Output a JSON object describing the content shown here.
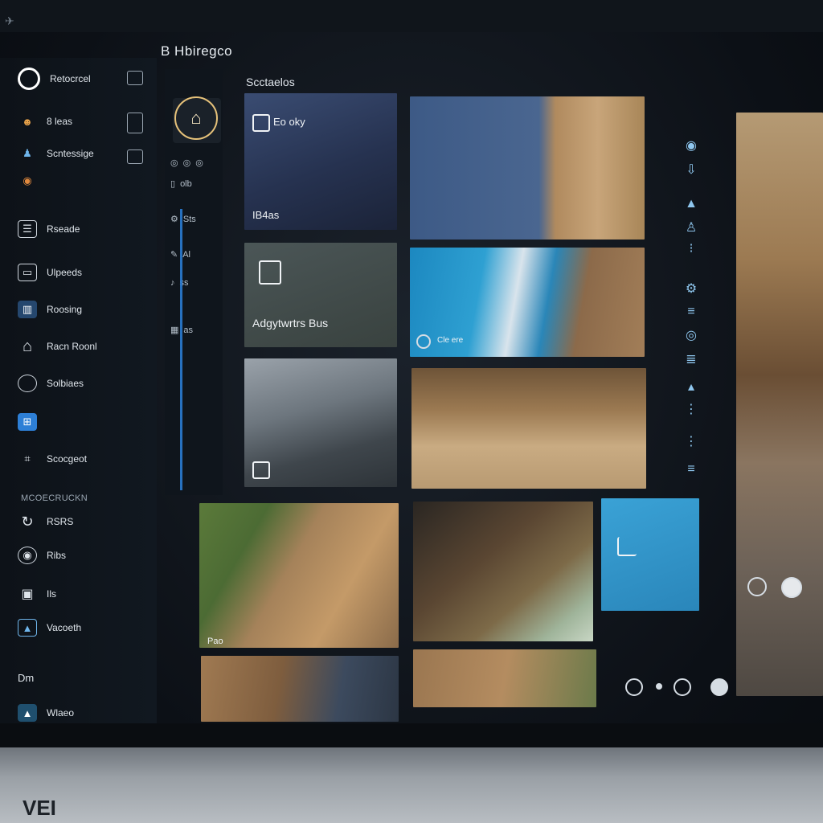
{
  "app": {
    "title": "B Hbiregco",
    "back_glyph": "✈"
  },
  "sidebar": {
    "items": [
      {
        "label": "Retocrcel",
        "icon": "circle-icon"
      },
      {
        "label": "8 leas",
        "icon": "emoji-icon"
      },
      {
        "label": "Scntessige",
        "icon": "person-icon"
      },
      {
        "label": "",
        "icon": "globe-icon"
      },
      {
        "label": "Rseade",
        "icon": "document-icon"
      },
      {
        "label": "Ulpeeds",
        "icon": "window-icon"
      },
      {
        "label": "Roosing",
        "icon": "chart-icon"
      },
      {
        "label": "Racn Roonl",
        "icon": "home-icon"
      },
      {
        "label": "Solbiaes",
        "icon": "disc-icon"
      },
      {
        "label": "",
        "icon": "windows-logo-icon"
      },
      {
        "label": "Scocgeot",
        "icon": "tag-icon"
      }
    ],
    "section_label": "MCOECRUCKN",
    "bottom_items": [
      {
        "label": "RSRS",
        "icon": "refresh-icon"
      },
      {
        "label": "Ribs",
        "icon": "eye-icon"
      },
      {
        "label": "Ils",
        "icon": "camera-icon"
      },
      {
        "label": "Vacoeth",
        "icon": "image-icon"
      },
      {
        "label": "Dm",
        "icon": ""
      },
      {
        "label": "Wlaeo",
        "icon": "photo-icon"
      }
    ]
  },
  "nav": {
    "rows": [
      "olb",
      "Sts",
      "Al",
      "ss",
      "as"
    ]
  },
  "content": {
    "section_title": "Scctaelos",
    "tiles": {
      "t1_top": "Eo oky",
      "t1_bottom": "IB4as",
      "t3_label": "Adgytwrtrs Bus",
      "t5_caption": "Cle ere",
      "t9_label": "Pao"
    }
  },
  "bezel": {
    "logo": "VEI"
  },
  "colors": {
    "accent": "#2d7fd6",
    "teal_tile": "#2a8ec0",
    "gold_ring": "#e6c27a"
  }
}
